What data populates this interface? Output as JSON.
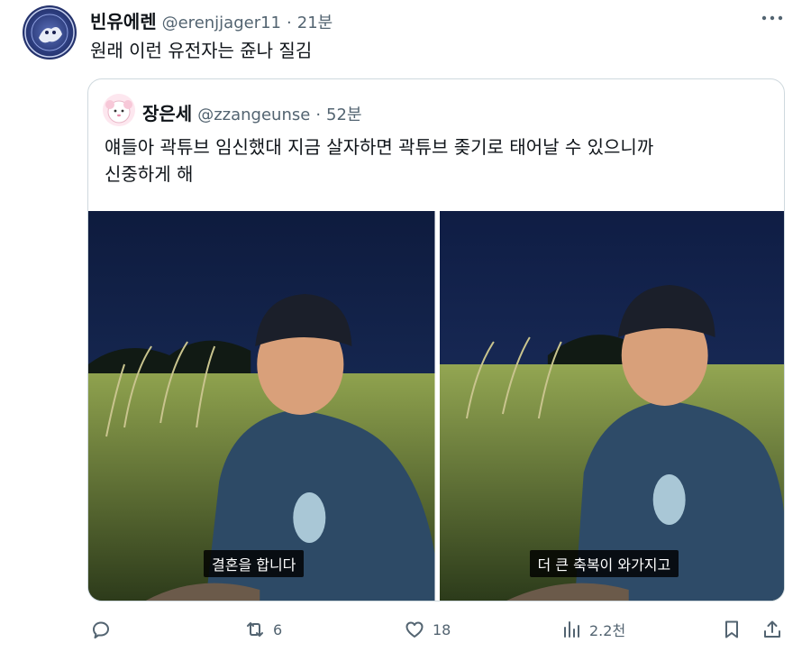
{
  "tweet": {
    "author": {
      "display_name": "빈유에렌",
      "handle": "@erenjjager11",
      "time": "21분"
    },
    "text": "원래 이런 유전자는 쥰나 질김"
  },
  "quote": {
    "author": {
      "display_name": "장은세",
      "handle": "@zzangeunse",
      "time": "52분"
    },
    "text_line1": "얘들아 곽튜브 임신했대 지금 살자하면 곽튜브 좆기로 태어날 수 있으니까",
    "text_line2": "신중하게 해",
    "media": [
      {
        "subtitle": "결혼을 합니다"
      },
      {
        "subtitle": "더 큰 축복이 와가지고"
      }
    ]
  },
  "actions": {
    "reply_count": "",
    "retweet_count": "6",
    "like_count": "18",
    "view_count": "2.2천"
  },
  "colors": {
    "text": "#0f1419",
    "muted": "#536471",
    "border": "#cfd9de"
  },
  "icons": [
    "more-icon",
    "reply-icon",
    "retweet-icon",
    "like-icon",
    "views-icon",
    "bookmark-icon",
    "share-icon"
  ]
}
